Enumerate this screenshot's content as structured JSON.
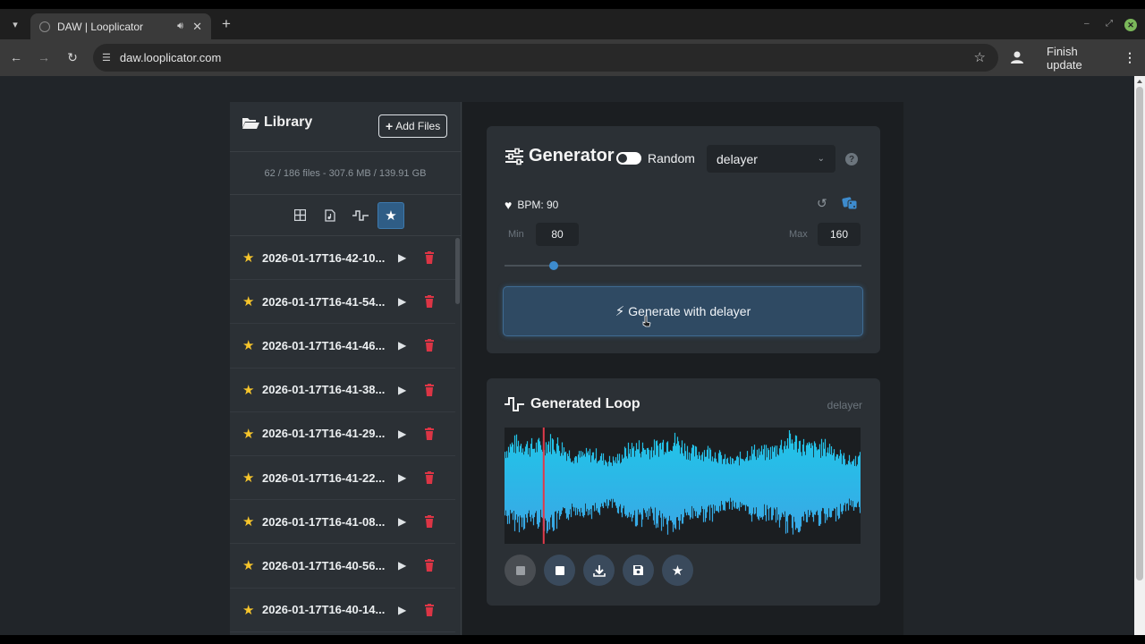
{
  "browser": {
    "tab_title": "DAW | Looplicator",
    "url": "daw.looplicator.com",
    "finish_update_label": "Finish update"
  },
  "library": {
    "title": "Library",
    "add_files_label": "Add Files",
    "stats": "62 / 186 files - 307.6 MB / 139.91 GB",
    "filters": [
      {
        "icon": "grid-icon",
        "active": false
      },
      {
        "icon": "file-audio-icon",
        "active": false
      },
      {
        "icon": "loop-wave-icon",
        "active": false
      },
      {
        "icon": "star-icon",
        "active": true
      }
    ],
    "files": [
      {
        "name": "2026-01-17T16-42-10..."
      },
      {
        "name": "2026-01-17T16-41-54..."
      },
      {
        "name": "2026-01-17T16-41-46..."
      },
      {
        "name": "2026-01-17T16-41-38..."
      },
      {
        "name": "2026-01-17T16-41-29..."
      },
      {
        "name": "2026-01-17T16-41-22..."
      },
      {
        "name": "2026-01-17T16-41-08..."
      },
      {
        "name": "2026-01-17T16-40-56..."
      },
      {
        "name": "2026-01-17T16-40-14..."
      }
    ]
  },
  "generator": {
    "title": "Generator",
    "random_label": "Random",
    "random_enabled": true,
    "algorithm": "delayer",
    "bpm_label": "BPM: 90",
    "min_label": "Min",
    "min_value": "80",
    "max_label": "Max",
    "max_value": "160",
    "bpm_slider_value": 90,
    "generate_label": "Generate with delayer"
  },
  "loop": {
    "title": "Generated Loop",
    "algorithm": "delayer",
    "playhead_fraction": 0.11,
    "controls": [
      "stop-icon",
      "stop-icon",
      "download-icon",
      "save-icon",
      "star-icon"
    ]
  },
  "colors": {
    "accent": "#3d8bcd",
    "star": "#f7c52b",
    "delete": "#dc3545",
    "waveform_top": "#1fc6e8",
    "waveform_bottom": "#3aa7e6",
    "playhead": "#e03a4a"
  }
}
